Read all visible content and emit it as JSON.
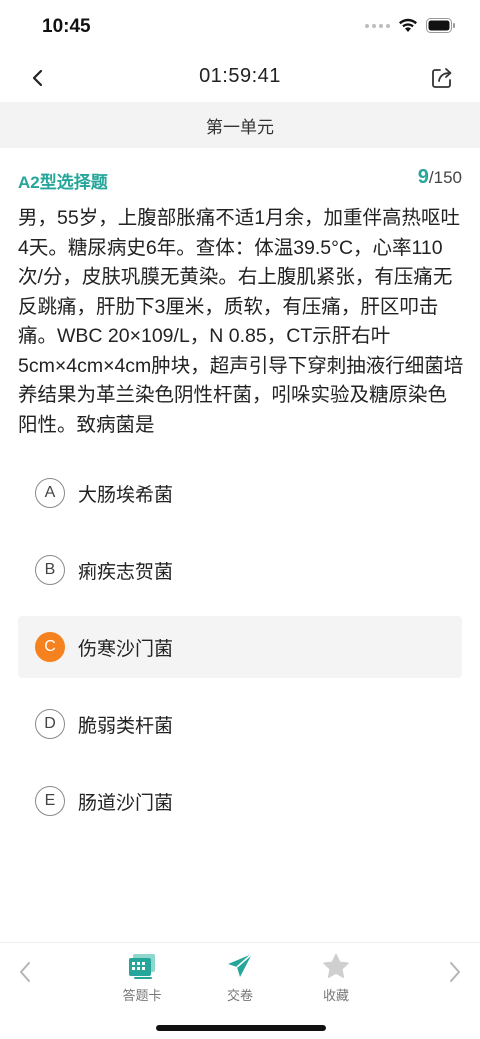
{
  "status_bar": {
    "time": "10:45"
  },
  "nav": {
    "timer": "01:59:41",
    "back_icon": "chevron-left-icon",
    "share_icon": "share-icon"
  },
  "unit": {
    "title": "第一单元"
  },
  "question": {
    "type": "A2型选择题",
    "index": "9",
    "total": "/150",
    "stem": "男，55岁，上腹部胀痛不适1月余，加重伴高热呕吐4天。糖尿病史6年。查体：体温39.5°C，心率110次/分，皮肤巩膜无黄染。右上腹肌紧张，有压痛无反跳痛，肝肋下3厘米，质软，有压痛，肝区叩击痛。WBC 20×109/L，N 0.85，CT示肝右叶5cm×4cm×4cm肿块，超声引导下穿刺抽液行细菌培养结果为革兰染色阴性杆菌，吲哚实验及糖原染色阳性。致病菌是"
  },
  "options": [
    {
      "letter": "A",
      "text": "大肠埃希菌",
      "selected": false
    },
    {
      "letter": "B",
      "text": "痢疾志贺菌",
      "selected": false
    },
    {
      "letter": "C",
      "text": "伤寒沙门菌",
      "selected": true
    },
    {
      "letter": "D",
      "text": "脆弱类杆菌",
      "selected": false
    },
    {
      "letter": "E",
      "text": "肠道沙门菌",
      "selected": false
    }
  ],
  "bottom_bar": {
    "answer_card_label": "答题卡",
    "submit_label": "交卷",
    "favorite_label": "收藏"
  },
  "colors": {
    "accent": "#26a69a",
    "selected": "#f5821f"
  }
}
